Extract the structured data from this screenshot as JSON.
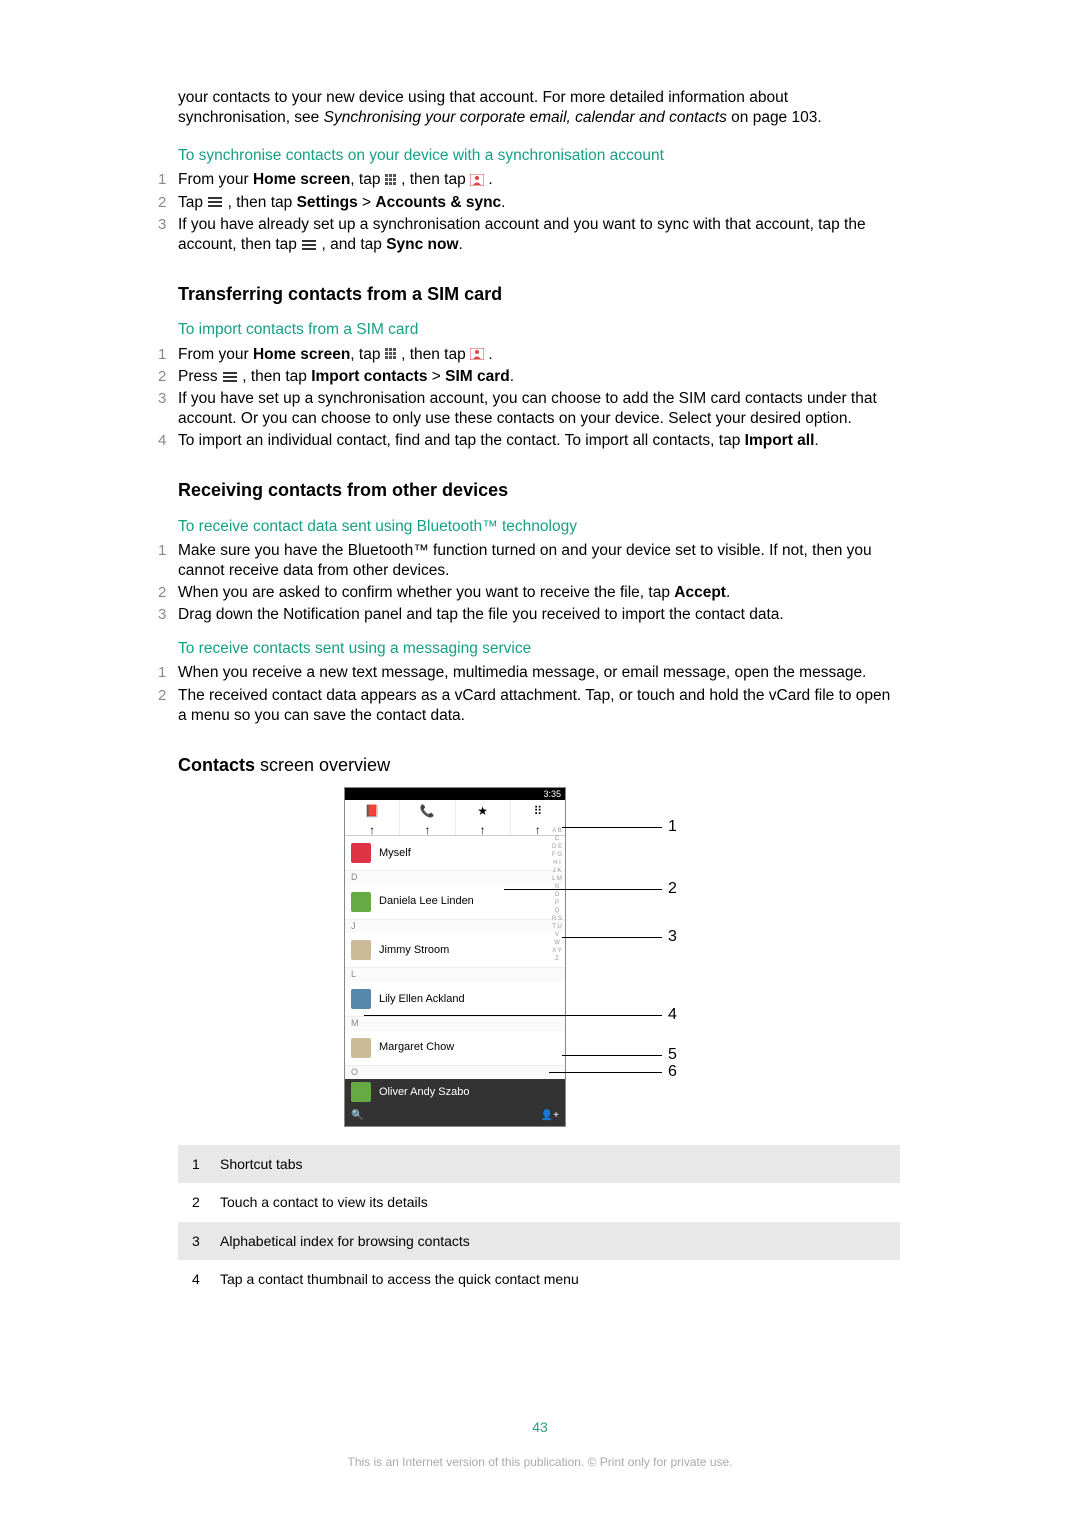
{
  "intro": {
    "line1_pre": "your contacts to your new device using that account. For more detailed information about synchronisation, see ",
    "line1_em": "Synchronising your corporate email, calendar and contacts",
    "line1_post": " on page 103."
  },
  "sec1": {
    "header": "To synchronise contacts on your device with a synchronisation account",
    "step1_a": "From your ",
    "step1_b": "Home screen",
    "step1_c": ", tap ",
    "step1_d": " , then tap ",
    "step1_e": " .",
    "step2_a": "Tap ",
    "step2_b": " , then tap ",
    "step2_c": "Settings",
    "step2_d": " > ",
    "step2_e": "Accounts & sync",
    "step2_f": ".",
    "step3_a": "If you have already set up a synchronisation account and you want to sync with that account, tap the account, then tap ",
    "step3_b": " , and tap ",
    "step3_c": "Sync now",
    "step3_d": "."
  },
  "sec2": {
    "title": "Transferring contacts from a SIM card",
    "header": "To import contacts from a SIM card",
    "step1_a": "From your ",
    "step1_b": "Home screen",
    "step1_c": ", tap ",
    "step1_d": " , then tap ",
    "step1_e": " .",
    "step2_a": "Press ",
    "step2_b": " , then tap ",
    "step2_c": "Import contacts",
    "step2_d": " > ",
    "step2_e": "SIM card",
    "step2_f": ".",
    "step3": "If you have set up a synchronisation account, you can choose to add the SIM card contacts under that account. Or you can choose to only use these contacts on your device. Select your desired option.",
    "step4_a": "To import an individual contact, find and tap the contact. To import all contacts, tap ",
    "step4_b": "Import all",
    "step4_c": "."
  },
  "sec3": {
    "title": "Receiving contacts from other devices",
    "h1": "To receive contact data sent using Bluetooth™ technology",
    "s1_1": "Make sure you have the Bluetooth™ function turned on and your device set to visible. If not, then you cannot receive data from other devices.",
    "s1_2a": "When you are asked to confirm whether you want to receive the file, tap ",
    "s1_2b": "Accept",
    "s1_2c": ".",
    "s1_3": "Drag down the Notification panel and tap the file you received to import the contact data.",
    "h2": "To receive contacts sent using a messaging service",
    "s2_1": "When you receive a new text message, multimedia message, or email message, open the message.",
    "s2_2": "The received contact data appears as a vCard attachment. Tap, or touch and hold the vCard file to open a menu so you can save the contact data."
  },
  "sec4": {
    "title_b": "Contacts",
    "title_r": " screen overview"
  },
  "phone": {
    "status": "3:35",
    "tab1": "📕",
    "tab2": "📞",
    "tab3": "★",
    "tab4": "⠿",
    "myself": "Myself",
    "sep_d": "D",
    "c1": "Daniela Lee Linden",
    "sep_j": "J",
    "c2": "Jimmy Stroom",
    "sep_l": "L",
    "c3": "Lily Ellen Ackland",
    "sep_m": "M",
    "c4": "Margaret Chow",
    "sep_o": "O",
    "c5": "Oliver Andy Szabo",
    "search": "🔍",
    "add": "👤+",
    "index": "A B C D E F G H I J K L M N O P Q R S T U V W X Y Z",
    "call": {
      "n1": "1",
      "n2": "2",
      "n3": "3",
      "n4": "4",
      "n5": "5",
      "n6": "6"
    }
  },
  "legend": {
    "r1n": "1",
    "r1t": "Shortcut tabs",
    "r2n": "2",
    "r2t": "Touch a contact to view its details",
    "r3n": "3",
    "r3t": "Alphabetical index for browsing contacts",
    "r4n": "4",
    "r4t": "Tap a contact thumbnail to access the quick contact menu"
  },
  "footer": {
    "page": "43",
    "copy": "This is an Internet version of this publication. © Print only for private use."
  }
}
